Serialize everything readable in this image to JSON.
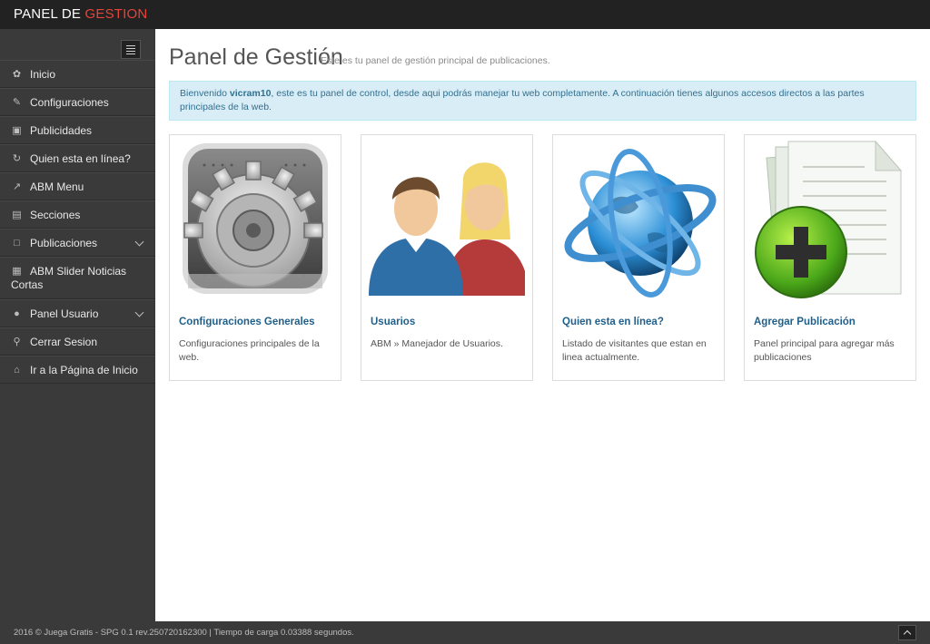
{
  "brand": {
    "part1": "PANEL DE ",
    "part2": "GESTION"
  },
  "sidebar": {
    "items": [
      {
        "icon": "leaf-icon",
        "label": "Inicio"
      },
      {
        "icon": "edit-icon",
        "label": "Configuraciones"
      },
      {
        "icon": "gift-icon",
        "label": "Publicidades"
      },
      {
        "icon": "refresh-icon",
        "label": "Quien esta en línea?"
      },
      {
        "icon": "external-link-icon",
        "label": "ABM Menu"
      },
      {
        "icon": "folder-open-icon",
        "label": "Secciones"
      },
      {
        "icon": "file-icon",
        "label": "Publicaciones"
      },
      {
        "icon": "image-icon",
        "label": "ABM Slider Noticias Cortas"
      },
      {
        "icon": "user-icon",
        "label": "Panel Usuario"
      },
      {
        "icon": "key-icon",
        "label": "Cerrar Sesion"
      },
      {
        "icon": "home-icon",
        "label": "Ir a la Página de Inicio"
      }
    ]
  },
  "header": {
    "title": "Panel de Gestión",
    "subtitle": "Este es tu panel de gestión principal de publicaciones."
  },
  "alert": {
    "prefix": "Bienvenido ",
    "username": "vicram10",
    "suffix": ", este es tu panel de control, desde aqui podrás manejar tu web completamente. A continuación tienes algunos accesos directos a las partes principales de la web."
  },
  "cards": [
    {
      "icon": "gear-icon",
      "title": "Configuraciones Generales",
      "desc": "Configuraciones principales de la web."
    },
    {
      "icon": "users-icon",
      "title": "Usuarios",
      "desc": "ABM » Manejador de Usuarios."
    },
    {
      "icon": "globe-icon",
      "title": "Quien esta en línea?",
      "desc": "Listado de visitantes que estan en linea actualmente."
    },
    {
      "icon": "add-document-icon",
      "title": "Agregar Publicación",
      "desc": "Panel principal para agregar más publicaciones"
    }
  ],
  "footer": {
    "text": "2016 © Juega Gratis - SPG 0.1 rev.250720162300 | Tiempo de carga 0.03388 segundos."
  },
  "colors": {
    "accent": "#e8433a",
    "link": "#1f5f8b",
    "sidebar": "#3a3a3a",
    "topbar": "#222222"
  }
}
